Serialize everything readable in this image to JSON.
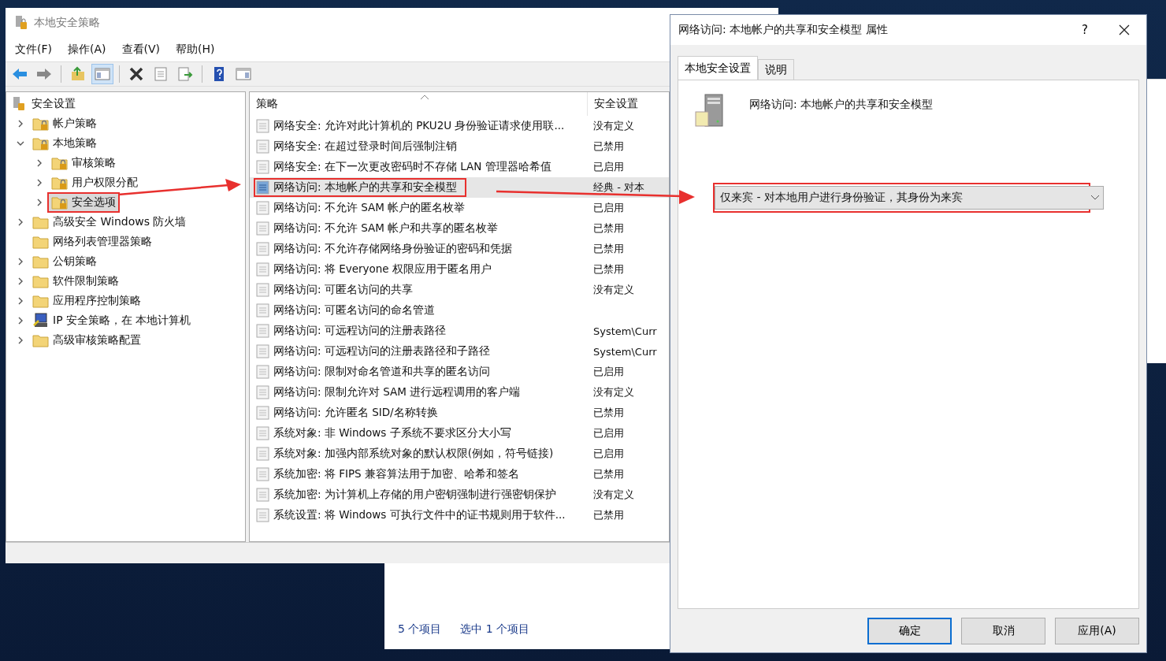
{
  "main_window": {
    "title": "本地安全策略",
    "menu": [
      "文件(F)",
      "操作(A)",
      "查看(V)",
      "帮助(H)"
    ],
    "toolbar": [
      {
        "kind": "back",
        "pressed": false
      },
      {
        "kind": "forward",
        "pressed": false
      },
      {
        "kind": "up",
        "pressed": false
      },
      {
        "kind": "tree",
        "pressed": true
      },
      {
        "kind": "delete",
        "pressed": false
      },
      {
        "kind": "properties",
        "pressed": false
      },
      {
        "kind": "export",
        "pressed": false
      },
      {
        "kind": "help",
        "pressed": false
      },
      {
        "kind": "view",
        "pressed": false
      }
    ],
    "tree": {
      "label": "安全设置",
      "children": [
        {
          "label": "帐户策略",
          "kind": "lock-folder",
          "expanded": false,
          "selected": false
        },
        {
          "label": "本地策略",
          "kind": "lock-folder",
          "expanded": true,
          "selected": false,
          "children": [
            {
              "label": "审核策略",
              "kind": "lock-folder",
              "expanded": false,
              "selected": false
            },
            {
              "label": "用户权限分配",
              "kind": "lock-folder",
              "expanded": false,
              "selected": false
            },
            {
              "label": "安全选项",
              "kind": "lock-folder",
              "expanded": false,
              "selected": true,
              "annotated": true
            }
          ]
        },
        {
          "label": "高级安全 Windows 防火墙",
          "kind": "folder",
          "expanded": false,
          "selected": false
        },
        {
          "label": "网络列表管理器策略",
          "kind": "folder",
          "selected": false
        },
        {
          "label": "公钥策略",
          "kind": "folder",
          "expanded": false,
          "selected": false
        },
        {
          "label": "软件限制策略",
          "kind": "folder",
          "expanded": false,
          "selected": false
        },
        {
          "label": "应用程序控制策略",
          "kind": "folder",
          "expanded": false,
          "selected": false
        },
        {
          "label": "IP 安全策略，在 本地计算机",
          "kind": "ip",
          "expanded": false,
          "selected": false
        },
        {
          "label": "高级审核策略配置",
          "kind": "folder",
          "expanded": false,
          "selected": false
        }
      ]
    },
    "list": {
      "columns": [
        "策略",
        "安全设置"
      ],
      "rows": [
        {
          "name": "网络安全: 允许对此计算机的 PKU2U 身份验证请求使用联...",
          "setting": "没有定义",
          "selected": false
        },
        {
          "name": "网络安全: 在超过登录时间后强制注销",
          "setting": "已禁用",
          "selected": false
        },
        {
          "name": "网络安全: 在下一次更改密码时不存储 LAN 管理器哈希值",
          "setting": "已启用",
          "selected": false
        },
        {
          "name": "网络访问: 本地帐户的共享和安全模型",
          "setting": "经典 - 对本",
          "selected": true,
          "annotated": true
        },
        {
          "name": "网络访问: 不允许 SAM 帐户的匿名枚举",
          "setting": "已启用",
          "selected": false
        },
        {
          "name": "网络访问: 不允许 SAM 帐户和共享的匿名枚举",
          "setting": "已禁用",
          "selected": false
        },
        {
          "name": "网络访问: 不允许存储网络身份验证的密码和凭据",
          "setting": "已禁用",
          "selected": false
        },
        {
          "name": "网络访问: 将 Everyone 权限应用于匿名用户",
          "setting": "已禁用",
          "selected": false
        },
        {
          "name": "网络访问: 可匿名访问的共享",
          "setting": "没有定义",
          "selected": false
        },
        {
          "name": "网络访问: 可匿名访问的命名管道",
          "selected": false
        },
        {
          "name": "网络访问: 可远程访问的注册表路径",
          "setting": "System\\Curr",
          "selected": false
        },
        {
          "name": "网络访问: 可远程访问的注册表路径和子路径",
          "setting": "System\\Curr",
          "selected": false
        },
        {
          "name": "网络访问: 限制对命名管道和共享的匿名访问",
          "setting": "已启用",
          "selected": false
        },
        {
          "name": "网络访问: 限制允许对 SAM 进行远程调用的客户端",
          "setting": "没有定义",
          "selected": false
        },
        {
          "name": "网络访问: 允许匿名 SID/名称转换",
          "setting": "已禁用",
          "selected": false
        },
        {
          "name": "系统对象: 非 Windows 子系统不要求区分大小写",
          "setting": "已启用",
          "selected": false
        },
        {
          "name": "系统对象: 加强内部系统对象的默认权限(例如，符号链接)",
          "setting": "已启用",
          "selected": false
        },
        {
          "name": "系统加密: 将 FIPS 兼容算法用于加密、哈希和签名",
          "setting": "已禁用",
          "selected": false
        },
        {
          "name": "系统加密: 为计算机上存储的用户密钥强制进行强密钥保护",
          "setting": "没有定义",
          "selected": false
        },
        {
          "name": "系统设置: 将 Windows 可执行文件中的证书规则用于软件...",
          "setting": "已禁用",
          "selected": false
        }
      ]
    }
  },
  "dialog": {
    "title": "网络访问: 本地帐户的共享和安全模型 属性",
    "help": "?",
    "tabs": [
      {
        "label": "本地安全设置",
        "selected": true
      },
      {
        "label": "说明",
        "selected": false
      }
    ],
    "policy_name": "网络访问: 本地帐户的共享和安全模型",
    "value": "仅来宾 - 对本地用户进行身份验证，其身份为来宾",
    "value_annotated": true,
    "buttons": [
      {
        "label": "确定",
        "default": true
      },
      {
        "label": "取消",
        "default": false
      },
      {
        "label": "应用(A)",
        "default": false
      }
    ]
  },
  "background_window": {
    "status": [
      "5 个项目",
      "选中 1 个项目"
    ]
  }
}
